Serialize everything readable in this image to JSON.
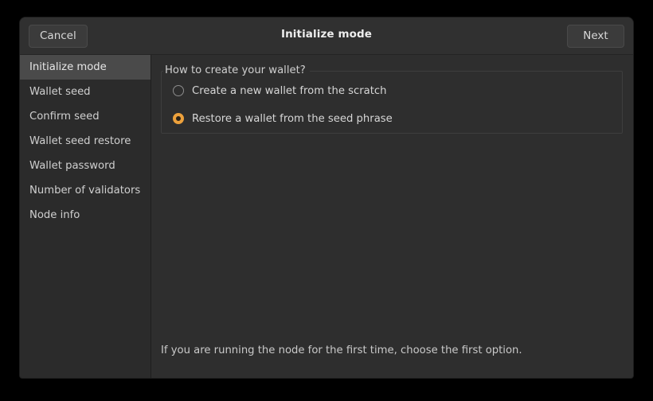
{
  "window": {
    "title": "Initialize mode",
    "cancel_label": "Cancel",
    "next_label": "Next"
  },
  "sidebar": {
    "items": [
      {
        "label": "Initialize mode",
        "selected": true
      },
      {
        "label": "Wallet seed",
        "selected": false
      },
      {
        "label": "Confirm seed",
        "selected": false
      },
      {
        "label": "Wallet seed restore",
        "selected": false
      },
      {
        "label": "Wallet password",
        "selected": false
      },
      {
        "label": "Number of validators",
        "selected": false
      },
      {
        "label": "Node info",
        "selected": false
      }
    ]
  },
  "main": {
    "group_title": "How to create your wallet?",
    "options": [
      {
        "label": "Create a new wallet from the scratch",
        "selected": false
      },
      {
        "label": "Restore a wallet from the seed phrase",
        "selected": true
      }
    ],
    "hint": "If you are running the node for the first time, choose the first option."
  },
  "colors": {
    "accent": "#eda13c",
    "window_bg": "#2e2e2e",
    "sidebar_bg": "#2b2b2b",
    "sidebar_selected_bg": "#4a4a4a",
    "header_bg": "#303030",
    "text": "#d6d6d6",
    "backdrop": "#000000"
  }
}
